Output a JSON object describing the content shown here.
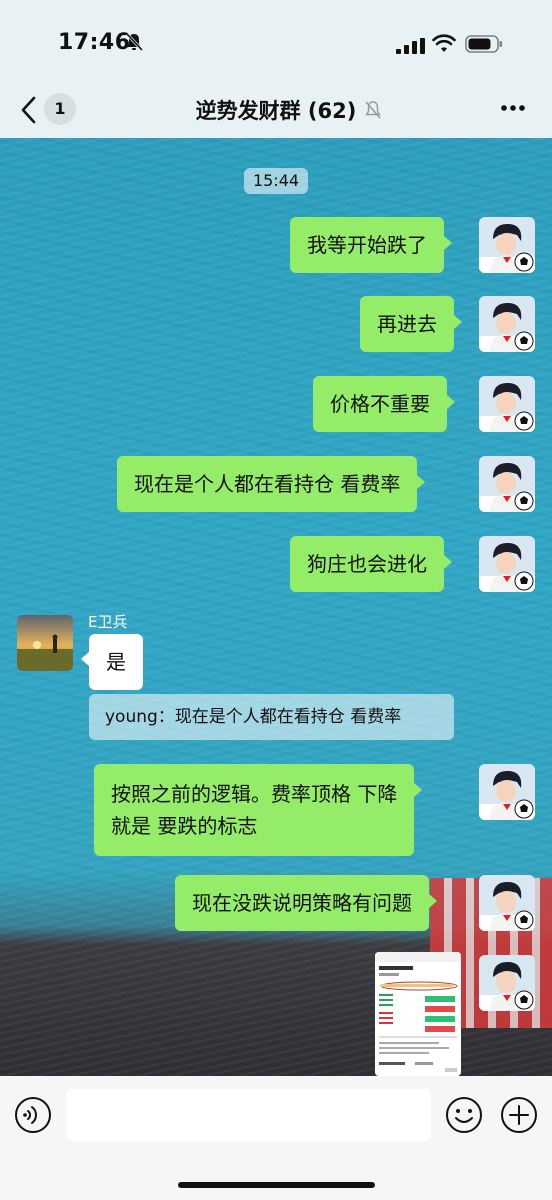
{
  "status_bar": {
    "time": "17:46"
  },
  "header": {
    "back_count": "1",
    "title": "逆势发财群 (62)"
  },
  "chat": {
    "timestamp": "15:44",
    "messages": [
      {
        "text": "我等开始跌了"
      },
      {
        "text": "再进去"
      },
      {
        "text": "价格不重要"
      },
      {
        "text": "现在是个人都在看持仓 看费率"
      },
      {
        "text": "狗庄也会进化"
      },
      {
        "sender": "E卫兵",
        "text": "是",
        "quote": "young：现在是个人都在看持仓 看费率"
      },
      {
        "text_line1": "按照之前的逻辑。费率顶格 下降",
        "text_line2": "就是 要跌的标志"
      },
      {
        "text": "现在没跌说明策略有问题"
      }
    ]
  },
  "input": {
    "value": "",
    "placeholder": ""
  },
  "colors": {
    "bubble_green": "#95ec69",
    "chat_bg": "#31a7c6"
  }
}
